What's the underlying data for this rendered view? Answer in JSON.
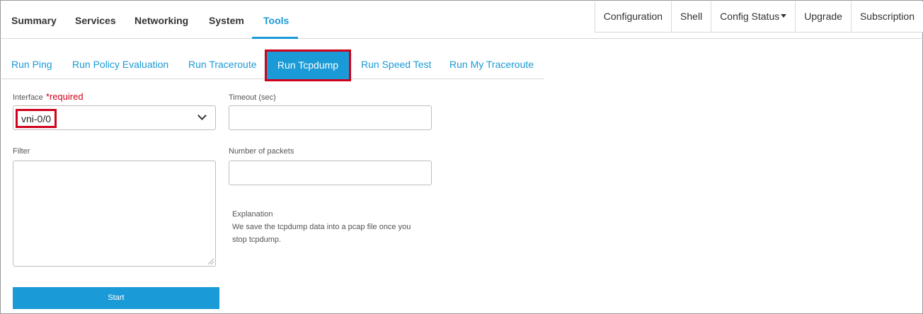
{
  "topnav": {
    "tabs": [
      {
        "label": "Summary"
      },
      {
        "label": "Services"
      },
      {
        "label": "Networking"
      },
      {
        "label": "System"
      },
      {
        "label": "Tools"
      }
    ],
    "active_tab": "Tools",
    "buttons": [
      {
        "label": "Configuration"
      },
      {
        "label": "Shell"
      },
      {
        "label": "Config Status"
      },
      {
        "label": "Upgrade"
      },
      {
        "label": "Subscription"
      }
    ]
  },
  "subtabs": [
    {
      "label": "Run Ping"
    },
    {
      "label": "Run Policy Evaluation"
    },
    {
      "label": "Run Traceroute"
    },
    {
      "label": "Run Tcpdump"
    },
    {
      "label": "Run Speed Test"
    },
    {
      "label": "Run My Traceroute"
    }
  ],
  "active_subtab": "Run Tcpdump",
  "form": {
    "interface": {
      "label": "Interface",
      "required": "*required",
      "value": "vni-0/0"
    },
    "timeout": {
      "label": "Timeout (sec)",
      "value": ""
    },
    "filter": {
      "label": "Filter",
      "value": ""
    },
    "packets": {
      "label": "Number of packets",
      "value": ""
    },
    "explanation_title": "Explanation",
    "explanation_line1": "We save the tcpdump data into a pcap file once you",
    "explanation_line2": "stop tcpdump.",
    "start_label": "Start"
  },
  "colors": {
    "accent": "#1a9ad6",
    "highlight": "#d0021b"
  }
}
